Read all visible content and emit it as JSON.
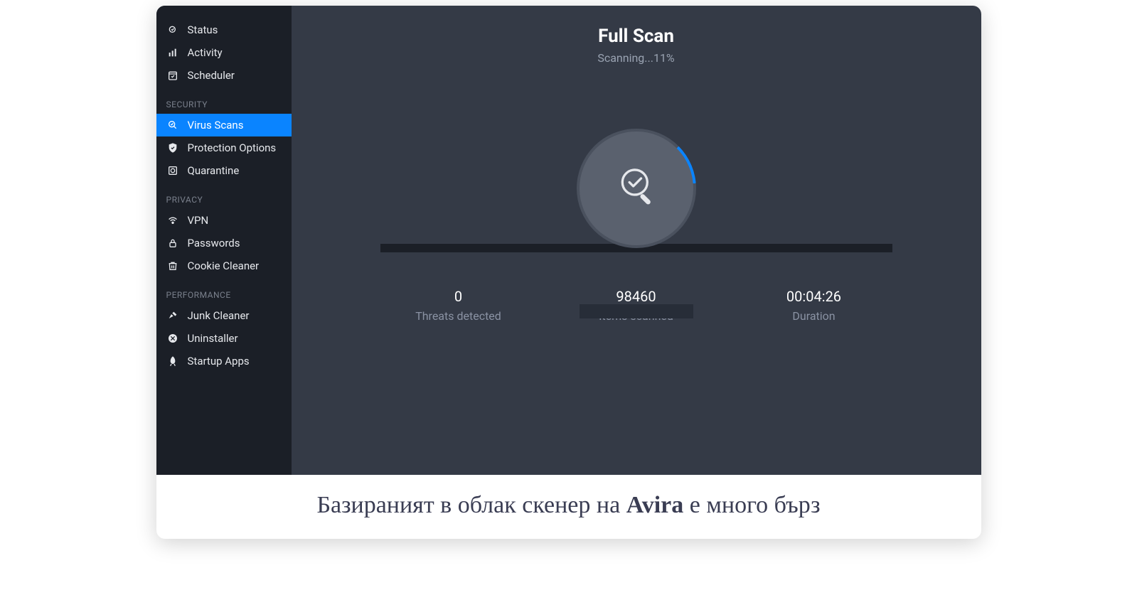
{
  "sidebar": {
    "top": [
      {
        "icon": "status-icon",
        "label": "Status"
      },
      {
        "icon": "activity-icon",
        "label": "Activity"
      },
      {
        "icon": "scheduler-icon",
        "label": "Scheduler"
      }
    ],
    "sections": [
      {
        "heading": "SECURITY",
        "items": [
          {
            "icon": "virus-scans-icon",
            "label": "Virus Scans",
            "active": true
          },
          {
            "icon": "protection-icon",
            "label": "Protection Options"
          },
          {
            "icon": "quarantine-icon",
            "label": "Quarantine"
          }
        ]
      },
      {
        "heading": "PRIVACY",
        "items": [
          {
            "icon": "vpn-icon",
            "label": "VPN"
          },
          {
            "icon": "passwords-icon",
            "label": "Passwords"
          },
          {
            "icon": "cookie-cleaner-icon",
            "label": "Cookie Cleaner"
          }
        ]
      },
      {
        "heading": "PERFORMANCE",
        "items": [
          {
            "icon": "junk-cleaner-icon",
            "label": "Junk Cleaner"
          },
          {
            "icon": "uninstaller-icon",
            "label": "Uninstaller"
          },
          {
            "icon": "startup-apps-icon",
            "label": "Startup Apps"
          }
        ]
      }
    ]
  },
  "scan": {
    "title": "Full Scan",
    "status": "Scanning...11%",
    "threats_value": "0",
    "threats_label": "Threats detected",
    "items_value": "98460",
    "items_label": "Items scanned",
    "duration_value": "00:04:26",
    "duration_label": "Duration"
  },
  "caption": {
    "pre": "Базираният в облак скенер на ",
    "brand": "Avira",
    "post": " е много бърз"
  }
}
